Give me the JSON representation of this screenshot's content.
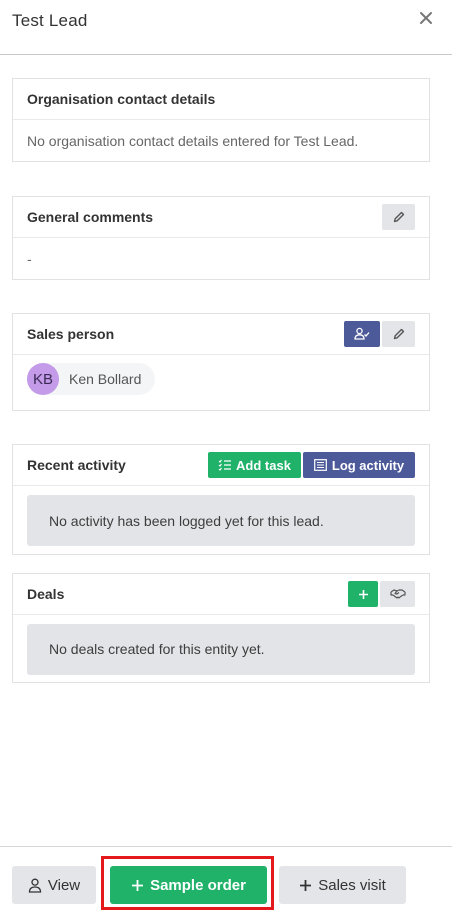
{
  "header": {
    "title": "Test Lead"
  },
  "organisation": {
    "title": "Organisation contact details",
    "body": "No organisation contact details entered for Test Lead."
  },
  "comments": {
    "title": "General comments",
    "body": "-"
  },
  "sales_person": {
    "title": "Sales person",
    "initials": "KB",
    "name": "Ken Bollard"
  },
  "activity": {
    "title": "Recent activity",
    "add_task_label": "Add task",
    "log_activity_label": "Log activity",
    "empty": "No activity has been logged yet for this lead."
  },
  "deals": {
    "title": "Deals",
    "empty": "No deals created for this entity yet."
  },
  "footer": {
    "view_label": "View",
    "sample_order_label": "Sample order",
    "sales_visit_label": "Sales visit"
  },
  "colors": {
    "green": "#21b26a",
    "blue": "#4d5a9a",
    "highlight": "#e3191b",
    "avatar": "#c39be8"
  }
}
